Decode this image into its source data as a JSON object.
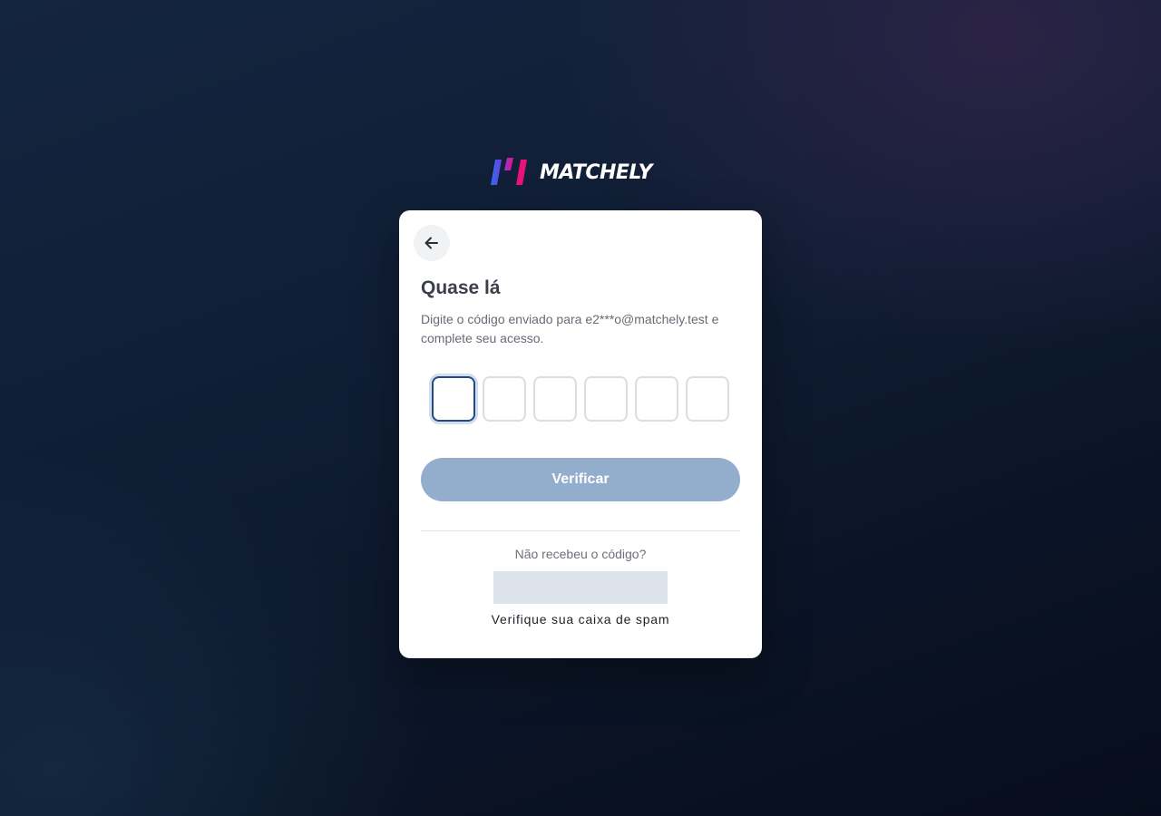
{
  "brand": {
    "name": "MATCHELY",
    "colors": {
      "blue": "#2f6bf0",
      "pink": "#e8127c"
    }
  },
  "card": {
    "back_icon": "arrow-left-icon",
    "title": "Quase lá",
    "subtitle": "Digite o código enviado para e2***o@matchely.test e complete seu acesso.",
    "otp": {
      "length": 6,
      "values": [
        "",
        "",
        "",
        "",
        "",
        ""
      ],
      "active_index": 0
    },
    "verify_label": "Verificar",
    "resend_question": "Não recebeu o código?",
    "spam_hint": "Verifique sua caixa de spam"
  },
  "colors": {
    "button_disabled": "#93aecd",
    "otp_focus": "#244a7e"
  }
}
